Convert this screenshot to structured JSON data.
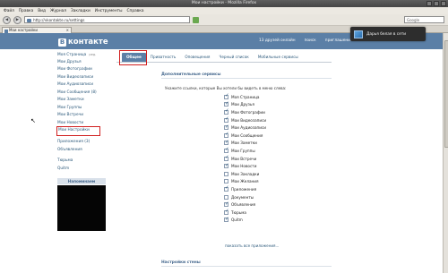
{
  "window": {
    "title": "Мои настройки - Mozilla Firefox"
  },
  "menubar": [
    "Файл",
    "Правка",
    "Вид",
    "Журнал",
    "Закладки",
    "Инструменты",
    "Справка"
  ],
  "nav": {
    "back": "◀",
    "forward": "▶",
    "url": "http://vkontakte.ru/settings",
    "search_placeholder": "Google"
  },
  "tab": {
    "title": "Мои настройки",
    "close": "×"
  },
  "header": {
    "logo_letter": "В",
    "logo_text": "контакте",
    "nav": [
      "13 друзей онлайн",
      "поиск",
      "приглашения"
    ],
    "brand_color": "#5b7fa6"
  },
  "popup": {
    "text": "Дарья белая в сети"
  },
  "sidebar": {
    "items": [
      {
        "label": "Моя Страница",
        "edit": "ред."
      },
      {
        "label": "Мои Друзья"
      },
      {
        "label": "Мои Фотографии"
      },
      {
        "label": "Мои Видеозаписи"
      },
      {
        "label": "Мои Аудиозаписи"
      },
      {
        "label": "Мои Сообщения (8)"
      },
      {
        "label": "Мои Заметки"
      },
      {
        "label": "Мои Группы"
      },
      {
        "label": "Мои Встречи"
      },
      {
        "label": "Мои Новости"
      },
      {
        "label": "Мои Настройки"
      }
    ],
    "items2": [
      {
        "label": "Приложения (3)"
      },
      {
        "label": "Объявления"
      }
    ],
    "items3": [
      {
        "label": "Тюрьма"
      },
      {
        "label": "Quitm"
      }
    ],
    "ad_head": "Напоминаем"
  },
  "content_tabs": [
    "Общее",
    "Приватность",
    "Оповещения",
    "Черный список",
    "Мобильные сервисы"
  ],
  "services": {
    "heading": "Дополнительные сервисы",
    "description": "Укажите ссылки, которые Вы хотели бы видеть в меню слева:",
    "items": [
      {
        "label": "Моя Страница",
        "checked": true
      },
      {
        "label": "Мои Друзья",
        "checked": true
      },
      {
        "label": "Мои Фотографии",
        "checked": true
      },
      {
        "label": "Мои Видеозаписи",
        "checked": true
      },
      {
        "label": "Мои Аудиозаписи",
        "checked": true
      },
      {
        "label": "Мои Сообщения",
        "checked": true
      },
      {
        "label": "Мои Заметки",
        "checked": true
      },
      {
        "label": "Мои Группы",
        "checked": true
      },
      {
        "label": "Мои Встречи",
        "checked": true
      },
      {
        "label": "Мои Новости",
        "checked": true
      },
      {
        "label": "Мои Закладки",
        "checked": false
      },
      {
        "label": "Мои Желания",
        "checked": false
      },
      {
        "label": "Приложения",
        "checked": true
      },
      {
        "label": "Документы",
        "checked": false
      },
      {
        "label": "Объявления",
        "checked": true
      },
      {
        "label": "Тюрьма",
        "checked": true
      },
      {
        "label": "Quitm",
        "checked": true
      }
    ],
    "show_all": "показать все приложения..."
  },
  "wall_heading": "Настройки стены"
}
